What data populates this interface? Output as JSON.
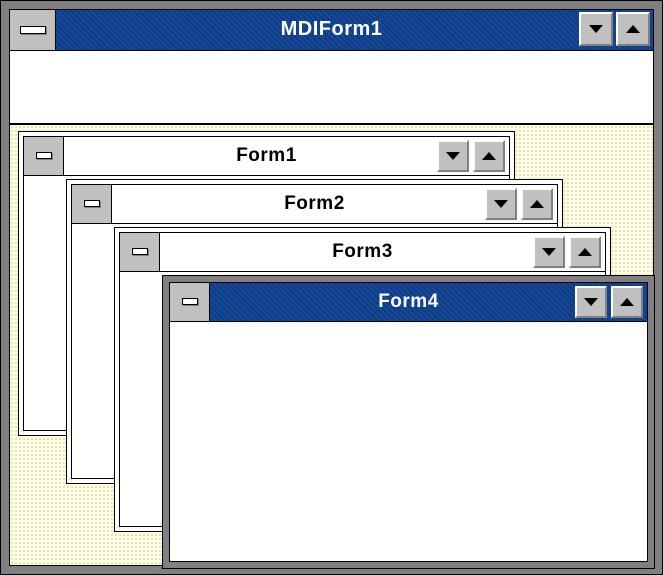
{
  "mdi": {
    "title": "MDIForm1",
    "icons": {
      "system_menu": "minus-icon",
      "minimize": "triangle-down-icon",
      "maximize": "triangle-up-icon"
    }
  },
  "forms": [
    {
      "title": "Form1",
      "active": false
    },
    {
      "title": "Form2",
      "active": false
    },
    {
      "title": "Form3",
      "active": false
    },
    {
      "title": "Form4",
      "active": true
    }
  ],
  "colors": {
    "active_title": "#0c3d8b",
    "inactive_title": "#ffffff",
    "button_face": "#c0c0c0",
    "frame": "#808080",
    "workspace": "#ffffe8"
  }
}
